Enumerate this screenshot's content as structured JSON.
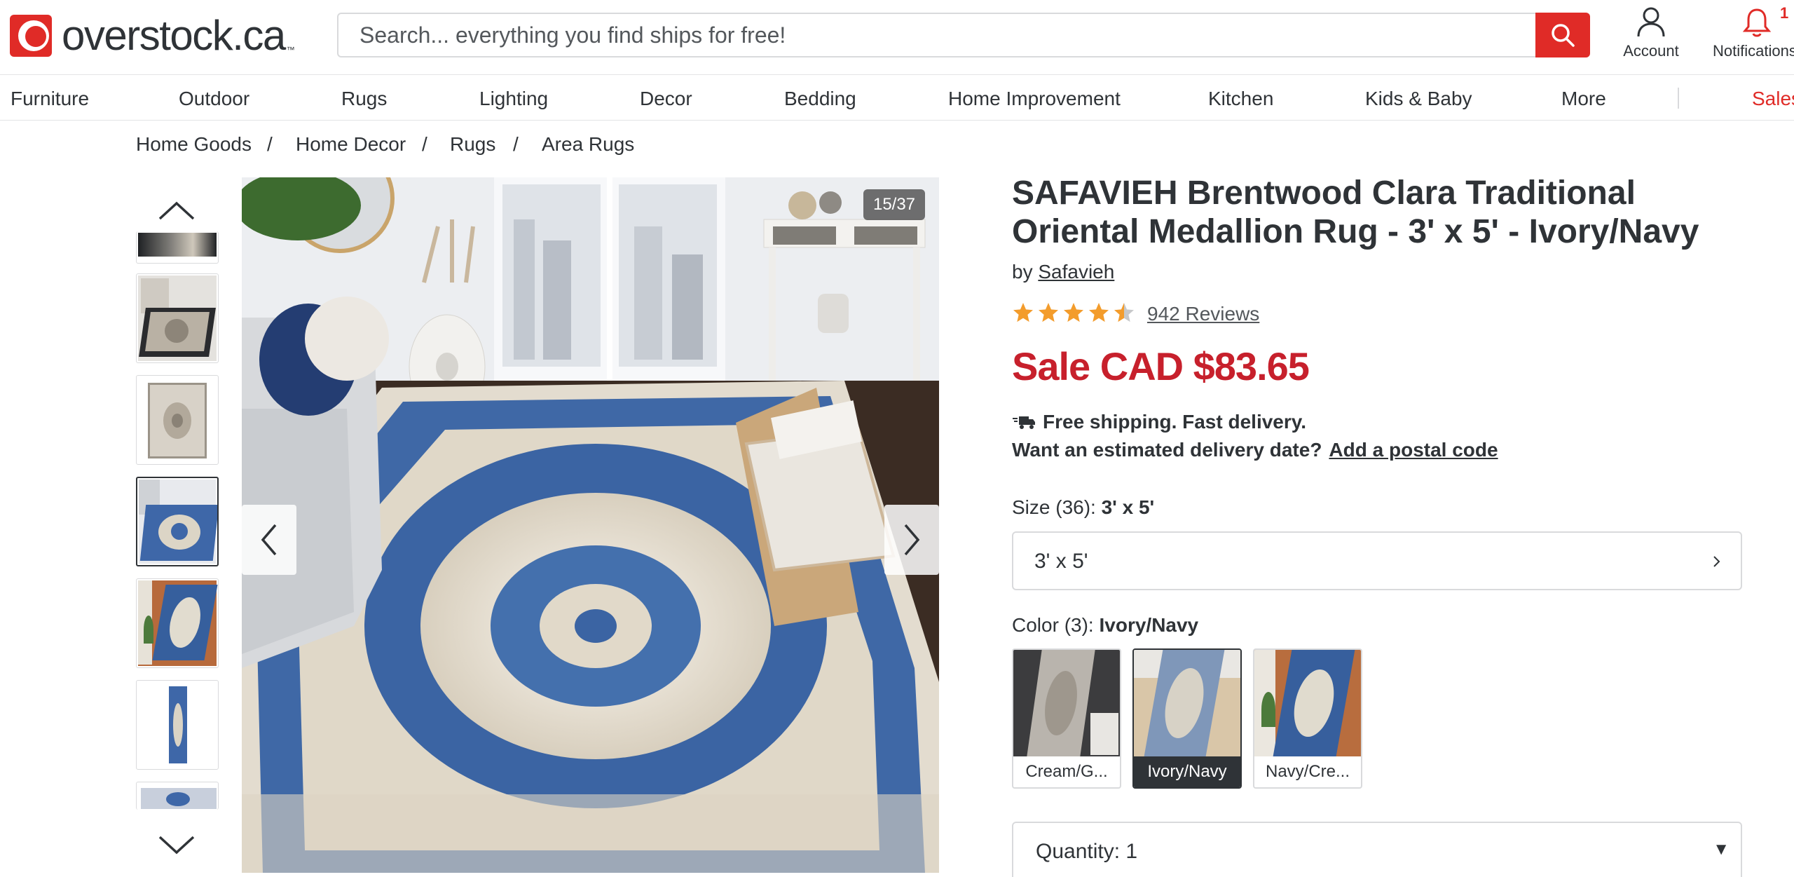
{
  "header": {
    "logo_text": "overstock.ca",
    "logo_tm": "™",
    "search_placeholder": "Search... everything you find ships for free!",
    "account_label": "Account",
    "notifications_label": "Notifications",
    "notifications_count": "1",
    "brand_color": "#e02b27"
  },
  "nav": {
    "items": [
      "Furniture",
      "Outdoor",
      "Rugs",
      "Lighting",
      "Decor",
      "Bedding",
      "Home Improvement",
      "Kitchen",
      "Kids & Baby",
      "More"
    ],
    "sales": "Sales"
  },
  "breadcrumb": {
    "items": [
      "Home Goods",
      "Home Decor",
      "Rugs",
      "Area Rugs"
    ],
    "separator": "/"
  },
  "gallery": {
    "counter": "15/37",
    "active_thumb": 3
  },
  "product": {
    "title": "SAFAVIEH Brentwood Clara Traditional Oriental Medallion Rug - 3' x 5' - Ivory/Navy",
    "by_prefix": "by",
    "brand": "Safavieh",
    "rating": 4.5,
    "reviews": "942 Reviews",
    "price": "Sale CAD $83.65",
    "price_color": "#c7202c",
    "shipping": "Free shipping. Fast delivery.",
    "delivery_question": "Want an estimated delivery date?",
    "delivery_link": "Add a postal code",
    "size_label": "Size (36):",
    "size_selected": "3' x 5'",
    "size_value": "3' x 5'",
    "color_label": "Color (3):",
    "color_selected": "Ivory/Navy",
    "colors": [
      "Cream/G...",
      "Ivory/Navy",
      "Navy/Cre..."
    ],
    "quantity": "Quantity: 1"
  }
}
